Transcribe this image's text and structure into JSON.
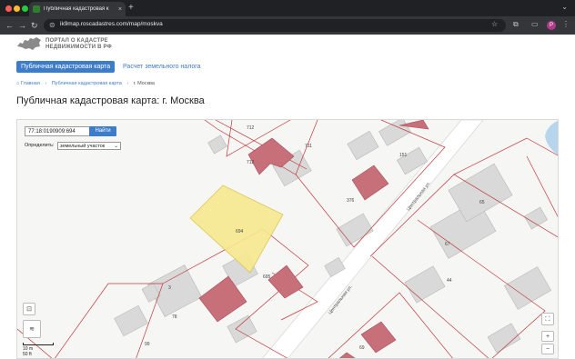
{
  "browser": {
    "tab_title": "Публичная кадастровая к",
    "tab_close": "×",
    "new_tab": "+",
    "url": "ik9map.roscadastres.com/map/moskva",
    "profile_initial": "P"
  },
  "header": {
    "logo_line1": "ПОРТАЛ О КАДАСТРЕ",
    "logo_line2": "НЕДВИЖИМОСТИ В РФ"
  },
  "nav": {
    "tab_map": "Публичная кадастровая карта",
    "tab_tax": "Расчет земельного налога"
  },
  "breadcrumbs": {
    "home": "Главная",
    "map": "Публичная кадастровая карта",
    "current": "г. Москва",
    "sep": "›"
  },
  "page": {
    "title": "Публичная кадастровая карта: г. Москва"
  },
  "map": {
    "search_value": "77:18:0190909:694",
    "search_button": "Найти",
    "define_label": "Определить:",
    "define_value": "земельный участок",
    "scale_m": "10 m",
    "scale_ft": "50 ft",
    "street_label": "Центральная ул.",
    "labels": {
      "l712a": "712",
      "l711": "711",
      "l712b": "712",
      "l151": "151",
      "l376": "376",
      "l694": "694",
      "l695": "695",
      "l65": "65",
      "l67": "67",
      "l44": "44",
      "l78": "78",
      "l99": "99",
      "l69": "69",
      "l3": "3"
    },
    "colors": {
      "selected_fill": "#f7e98f",
      "selected_stroke": "#d8c24a",
      "building_fill": "#c8707a",
      "boundary": "#c0393b"
    }
  }
}
